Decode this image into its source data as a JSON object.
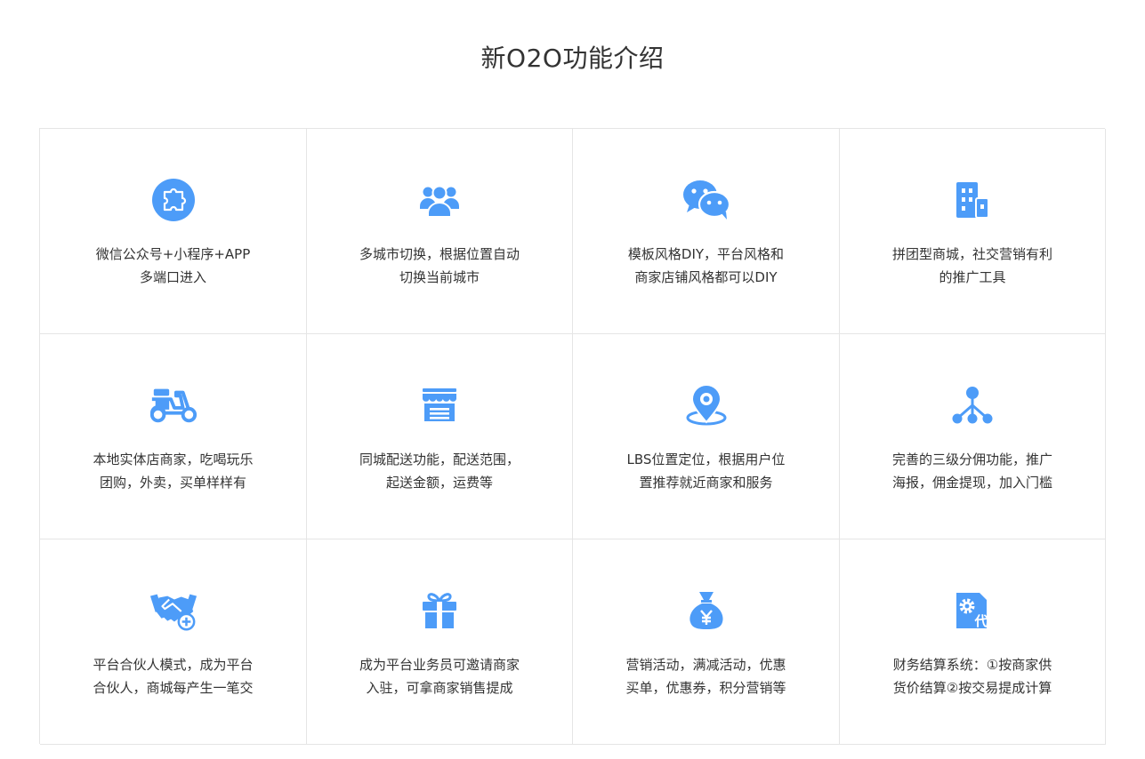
{
  "page": {
    "title": "新O2O功能介绍",
    "accent_color": "#4d9cf8"
  },
  "features": [
    {
      "icon": "puzzle-icon",
      "line1": "微信公众号+小程序+APP",
      "line2": "多端口进入"
    },
    {
      "icon": "users-group-icon",
      "line1": "多城市切换，根据位置自动",
      "line2": "切换当前城市"
    },
    {
      "icon": "wechat-icon",
      "line1": "模板风格DIY，平台风格和",
      "line2": "商家店铺风格都可以DIY"
    },
    {
      "icon": "building-icon",
      "line1": "拼团型商城，社交营销有利",
      "line2": "的推广工具"
    },
    {
      "icon": "scooter-icon",
      "line1": "本地实体店商家，吃喝玩乐",
      "line2": "团购，外卖，买单样样有"
    },
    {
      "icon": "store-icon",
      "line1": "同城配送功能，配送范围，",
      "line2": "起送金额，运费等"
    },
    {
      "icon": "location-pin-icon",
      "line1": "LBS位置定位，根据用户位",
      "line2": "置推荐就近商家和服务"
    },
    {
      "icon": "hierarchy-icon",
      "line1": "完善的三级分佣功能，推广",
      "line2": "海报，佣金提现，加入门槛"
    },
    {
      "icon": "handshake-icon",
      "line1": "平台合伙人模式，成为平台",
      "line2": "合伙人，商城每产生一笔交"
    },
    {
      "icon": "gift-icon",
      "line1": "成为平台业务员可邀请商家",
      "line2": "入驻，可拿商家销售提成"
    },
    {
      "icon": "money-bag-icon",
      "line1": "营销活动，满减活动，优惠",
      "line2": "买单，优惠券，积分营销等"
    },
    {
      "icon": "finance-settings-icon",
      "line1": "财务结算系统：①按商家供",
      "line2": "货价结算②按交易提成计算",
      "badge": "代"
    }
  ]
}
